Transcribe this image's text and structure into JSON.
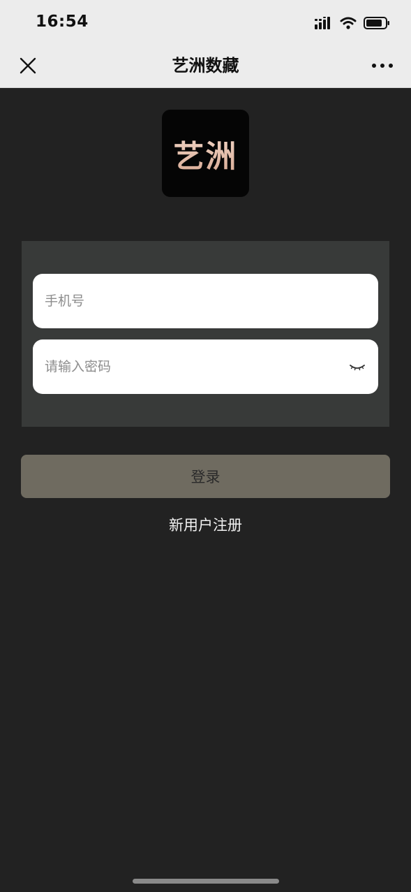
{
  "status_bar": {
    "time": "16:54",
    "icons": [
      "signal-icon",
      "wifi-icon",
      "battery-icon"
    ]
  },
  "nav": {
    "title": "艺洲数藏",
    "close_icon": "close-icon",
    "more_icon": "more-icon"
  },
  "logo": {
    "text": "艺洲"
  },
  "form": {
    "phone_placeholder": "手机号",
    "password_placeholder": "请输入密码",
    "password_toggle_icon": "eye-closed-icon"
  },
  "actions": {
    "login_label": "登录",
    "register_label": "新用户注册"
  },
  "colors": {
    "background": "#222222",
    "topbar": "#ececec",
    "panel": "#383a39",
    "login_button": "#6f6b60",
    "logo_text": "#e8c7b8"
  }
}
